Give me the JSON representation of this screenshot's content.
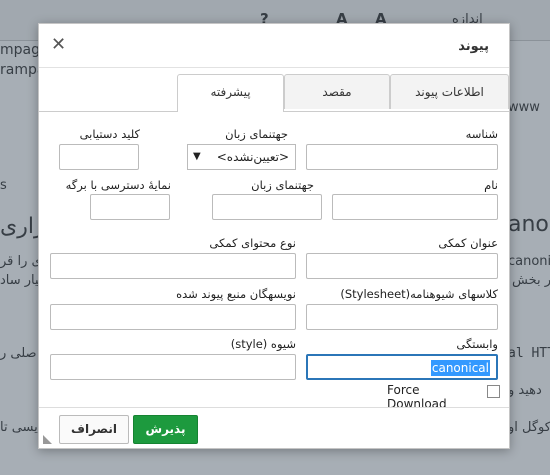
{
  "background": {
    "texts": [
      "mpage",
      "rampa",
      "s",
      "anoni",
      "راری",
      "canonic",
      "ی را قر",
      "سیار ساد",
      "در بخش",
      "al HTT",
      "صلی ر",
      "دهید و",
      "یسی تا",
      "کوگل او",
      "www"
    ],
    "toolbar": [
      "اندازه",
      "?",
      "A",
      "A"
    ]
  },
  "dialog": {
    "title": "پیوند",
    "close_label": "✕",
    "tabs": [
      {
        "label": "اطلاعات پیوند",
        "active": false
      },
      {
        "label": "مقصد",
        "active": false
      },
      {
        "label": "پیشرفته",
        "active": true
      }
    ],
    "fields": {
      "id_label": "شناسه",
      "lang_dir_label": "جهتنمای زبان",
      "lang_dir_value": "<تعیین‌نشده>",
      "access_key_label": "کلید دستیابی",
      "name_label": "نام",
      "lang_code_label": "جهتنمای زبان",
      "tab_index_label": "نمایهٔ دسترسی با برگه",
      "advisory_title_label": "عنوان کمکی",
      "advisory_type_label": "نوع محتوای کمکی",
      "stylesheet_classes_label": "کلاسهای شیوهنامه(Stylesheet)",
      "charset_label": "نویسهگان منبع پیوند شده",
      "rel_label": "وابستگی",
      "rel_value": "canonical",
      "style_label": "شیوه (style)",
      "force_download_label": "Force Download"
    },
    "buttons": {
      "ok": "پذیرش",
      "cancel": "انصراف"
    }
  }
}
